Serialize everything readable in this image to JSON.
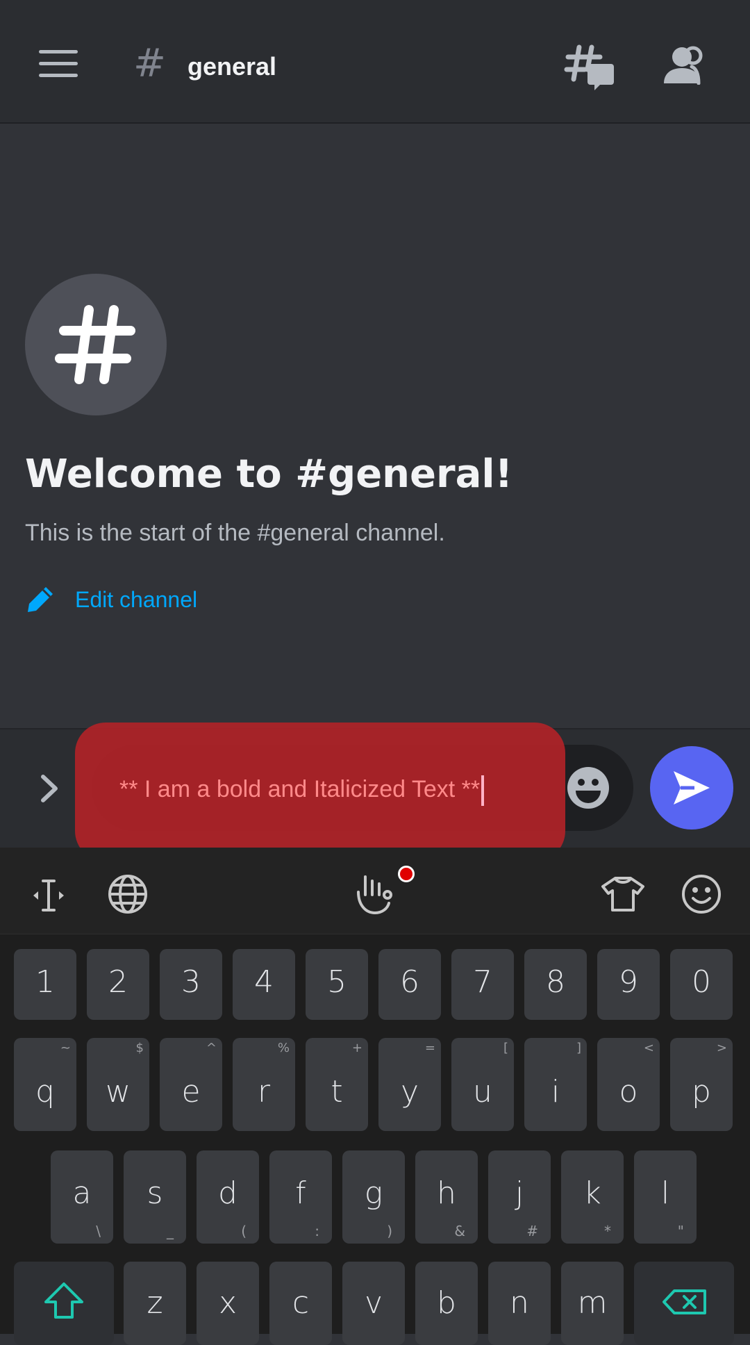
{
  "header": {
    "channel_name": "general",
    "hash_symbol": "#"
  },
  "welcome": {
    "avatar_symbol": "#",
    "title": "Welcome to #general!",
    "subtitle": "This is the start of the #general channel.",
    "edit_channel_label": "Edit channel"
  },
  "composer": {
    "input_value": "** I am a bold and Italicized Text **"
  },
  "keyboard": {
    "number_row": [
      "1",
      "2",
      "3",
      "4",
      "5",
      "6",
      "7",
      "8",
      "9",
      "0"
    ],
    "row1": [
      {
        "key": "q",
        "alt": "~"
      },
      {
        "key": "w",
        "alt": "$"
      },
      {
        "key": "e",
        "alt": "^"
      },
      {
        "key": "r",
        "alt": "%"
      },
      {
        "key": "t",
        "alt": "+"
      },
      {
        "key": "y",
        "alt": "="
      },
      {
        "key": "u",
        "alt": "["
      },
      {
        "key": "i",
        "alt": "]"
      },
      {
        "key": "o",
        "alt": "<"
      },
      {
        "key": "p",
        "alt": ">"
      }
    ],
    "row2": [
      {
        "key": "a",
        "alt": "\\"
      },
      {
        "key": "s",
        "alt": "_"
      },
      {
        "key": "d",
        "alt": "("
      },
      {
        "key": "f",
        "alt": ":"
      },
      {
        "key": "g",
        "alt": ")"
      },
      {
        "key": "h",
        "alt": "&"
      },
      {
        "key": "j",
        "alt": "#"
      },
      {
        "key": "k",
        "alt": "*"
      },
      {
        "key": "l",
        "alt": "\""
      }
    ],
    "row3": [
      {
        "key": "z",
        "alt": ""
      },
      {
        "key": "x",
        "alt": ""
      },
      {
        "key": "c",
        "alt": ""
      },
      {
        "key": "v",
        "alt": ""
      },
      {
        "key": "b",
        "alt": ""
      },
      {
        "key": "n",
        "alt": ""
      },
      {
        "key": "m",
        "alt": ""
      }
    ]
  },
  "colors": {
    "background": "#313338",
    "accent_blue": "#5865f2",
    "link_blue": "#00a8fc",
    "highlight_red": "#b22228"
  }
}
